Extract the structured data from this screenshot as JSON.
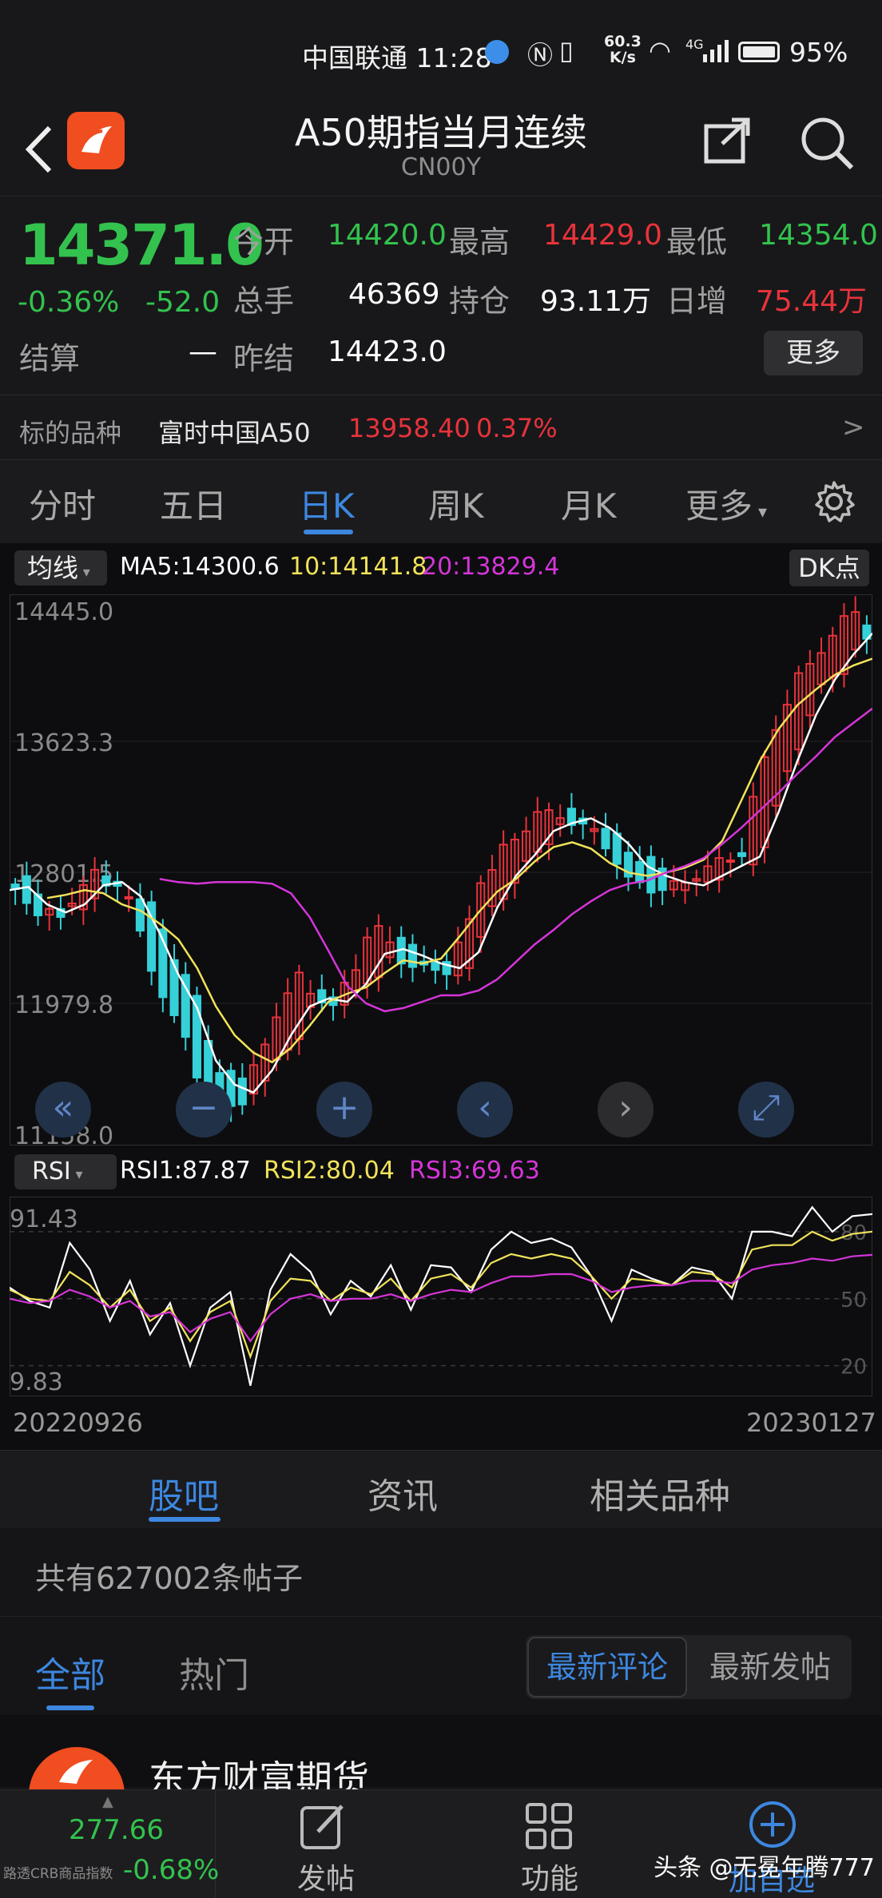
{
  "status_bar": {
    "carrier": "中国联通 11:28",
    "net_speed_value": "60.3",
    "net_speed_unit": "K/s",
    "signal": "4G",
    "battery": "95%"
  },
  "header": {
    "title": "A50期指当月连续",
    "code": "CN00Y"
  },
  "quote": {
    "price": "14371.0",
    "change_pct": "-0.36%",
    "change": "-52.0",
    "rows": [
      [
        {
          "label": "今开",
          "value": "14420.0",
          "color": "green"
        },
        {
          "label": "最高",
          "value": "14429.0",
          "color": "red"
        },
        {
          "label": "最低",
          "value": "14354.0",
          "color": "green"
        }
      ],
      [
        {
          "label": "总手",
          "value": "46369",
          "color": "white"
        },
        {
          "label": "持仓",
          "value": "93.11万",
          "color": "white"
        },
        {
          "label": "日增",
          "value": "75.44万",
          "color": "red"
        }
      ]
    ],
    "settle_label": "结算",
    "settle_value": "—",
    "prev_settle_label": "昨结",
    "prev_settle_value": "14423.0",
    "more_button": "更多"
  },
  "underlying": {
    "label": "标的品种",
    "name": "富时中国A50",
    "price": "13958.40",
    "pct": "0.37%",
    "arrow": ">"
  },
  "period_tabs": [
    "分时",
    "五日",
    "日K",
    "周K",
    "月K",
    "更多"
  ],
  "active_tab": 2,
  "ma_legend": {
    "selector": "均线",
    "ma5": "MA5:14300.6",
    "ma10": "10:14141.8",
    "ma20": "20:13829.4",
    "dk_button": "DK点"
  },
  "rsi_legend": {
    "selector": "RSI",
    "rsi1": "RSI1:87.87",
    "rsi2": "RSI2:80.04",
    "rsi3": "RSI3:69.63"
  },
  "x_axis": {
    "start": "20220926",
    "end": "20230127"
  },
  "chart_controls": [
    "«",
    "−",
    "+",
    "‹",
    "›",
    "⤢"
  ],
  "colors": {
    "up": "#e8333b",
    "down": "#35d0d8",
    "ma5": "#ffffff",
    "ma10": "#f1e35a",
    "ma20": "#d535d8",
    "accent": "#3d87e0"
  },
  "chart_data": [
    {
      "type": "line",
      "ylim": [
        11158.0,
        14445.0
      ],
      "yticks": [
        14445.0,
        13623.3,
        12801.5,
        11979.8,
        11158.0
      ],
      "series": [
        {
          "name": "MA5",
          "values": [
            12690,
            12710,
            12600,
            12550,
            12600,
            12720,
            12740,
            12650,
            12420,
            12160,
            11950,
            11620,
            11470,
            11420,
            11560,
            11780,
            11960,
            12010,
            11990,
            12100,
            12290,
            12320,
            12280,
            12230,
            12200,
            12300,
            12580,
            12780,
            12910,
            13060,
            13110,
            13140,
            13080,
            12980,
            12840,
            12780,
            12740,
            12720,
            12780,
            12840,
            12900,
            13180,
            13500,
            13790,
            14010,
            14170,
            14300
          ]
        },
        {
          "name": "MA10",
          "values": [
            12640,
            12660,
            12690,
            12670,
            12600,
            12560,
            12480,
            12380,
            12200,
            11960,
            11780,
            11670,
            11610,
            11700,
            11840,
            11990,
            12040,
            12080,
            12170,
            12250,
            12230,
            12260,
            12400,
            12550,
            12680,
            12760,
            12870,
            12960,
            12990,
            12950,
            12860,
            12800,
            12780,
            12800,
            12830,
            12880,
            13000,
            13250,
            13500,
            13700,
            13850,
            13950,
            14040,
            14100,
            14141.8
          ]
        },
        {
          "name": "MA20",
          "values": [
            12760,
            12740,
            12730,
            12740,
            12740,
            12740,
            12730,
            12670,
            12520,
            12310,
            12090,
            11980,
            11930,
            11950,
            11990,
            12030,
            12030,
            12060,
            12130,
            12240,
            12350,
            12440,
            12540,
            12620,
            12690,
            12730,
            12750,
            12800,
            12840,
            12890,
            12980,
            13080,
            13190,
            13300,
            13420,
            13530,
            13650,
            13740,
            13829.4
          ]
        }
      ]
    },
    {
      "type": "line",
      "ylim": [
        9.83,
        91.43
      ],
      "reference_lines": [
        80,
        50,
        20
      ],
      "series": [
        {
          "name": "RSI1",
          "values": [
            55,
            49,
            46,
            75,
            63,
            40,
            58,
            34,
            48,
            20,
            46,
            53,
            11,
            54,
            70,
            62,
            43,
            58,
            51,
            65,
            45,
            65,
            64,
            53,
            72,
            80,
            75,
            77,
            73,
            60,
            40,
            63,
            59,
            56,
            64,
            62,
            50,
            80,
            80,
            78,
            91,
            80,
            87,
            87.87
          ]
        },
        {
          "name": "RSI2",
          "values": [
            54,
            50,
            49,
            62,
            56,
            46,
            54,
            40,
            46,
            31,
            44,
            49,
            24,
            49,
            59,
            58,
            49,
            55,
            52,
            59,
            49,
            59,
            61,
            55,
            66,
            70,
            68,
            70,
            68,
            60,
            50,
            59,
            58,
            56,
            62,
            61,
            55,
            72,
            74,
            74,
            80,
            76,
            79,
            80.04
          ]
        },
        {
          "name": "RSI3",
          "values": [
            50,
            48,
            49,
            54,
            51,
            46,
            49,
            42,
            44,
            35,
            41,
            44,
            31,
            43,
            50,
            52,
            49,
            50,
            50,
            52,
            49,
            52,
            54,
            53,
            57,
            60,
            60,
            61,
            61,
            58,
            53,
            55,
            56,
            56,
            58,
            58,
            57,
            63,
            65,
            66,
            68,
            67,
            69,
            69.63
          ]
        }
      ]
    }
  ],
  "community": {
    "tabs": [
      "股吧",
      "资讯",
      "相关品种"
    ],
    "post_count": "共有627002条帖子",
    "filters": [
      "全部",
      "热门"
    ],
    "sort_buttons": [
      "最新评论",
      "最新发帖"
    ],
    "first_author": "东方财富期货"
  },
  "bottom_bar": {
    "crb_value": "277.66",
    "crb_label": "路透CRB商品指数",
    "crb_pct": "-0.68%",
    "items": [
      "发帖",
      "功能",
      "加自选"
    ],
    "watermark": "头条 @无冕年腾777"
  }
}
